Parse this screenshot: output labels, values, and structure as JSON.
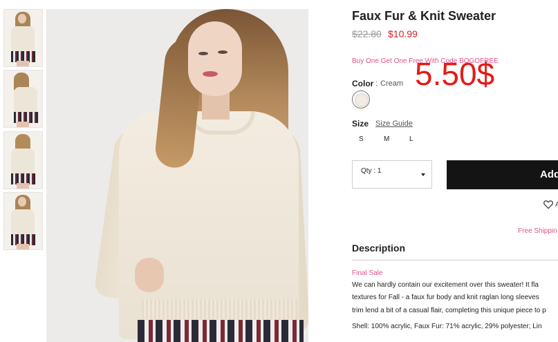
{
  "product": {
    "title": "Faux Fur & Knit Sweater",
    "price_original": "$22.80",
    "price_sale": "$10.99",
    "promo": "Buy One Get One Free With Code BOGOFREE",
    "overlay_price": "5.50$"
  },
  "color": {
    "label": "Color",
    "separator": ":",
    "value": "Cream",
    "swatch_hex": "#f0ece3"
  },
  "size": {
    "label": "Size",
    "guide_link": "Size Guide",
    "options": [
      "S",
      "M",
      "L"
    ]
  },
  "cart": {
    "qty_label": "Qty : 1",
    "add_button_visible": "Add",
    "wishlist_visible": "A",
    "free_shipping_visible": "Free Shippin"
  },
  "description": {
    "title": "Description",
    "final_sale": "Final Sale",
    "lines": [
      "We can hardly contain our excitement over this sweater! It fla",
      "textures for Fall - a faux fur body and knit raglan long sleeves",
      "trim lend a bit of a casual flair, completing this unique piece to p",
      "Shell: 100% acrylic, Faux Fur: 71% acrylic, 29% polyester; Lin"
    ]
  },
  "colors": {
    "sale_red": "#d41f2a",
    "promo_pink": "#e0508a",
    "button_black": "#141414"
  }
}
